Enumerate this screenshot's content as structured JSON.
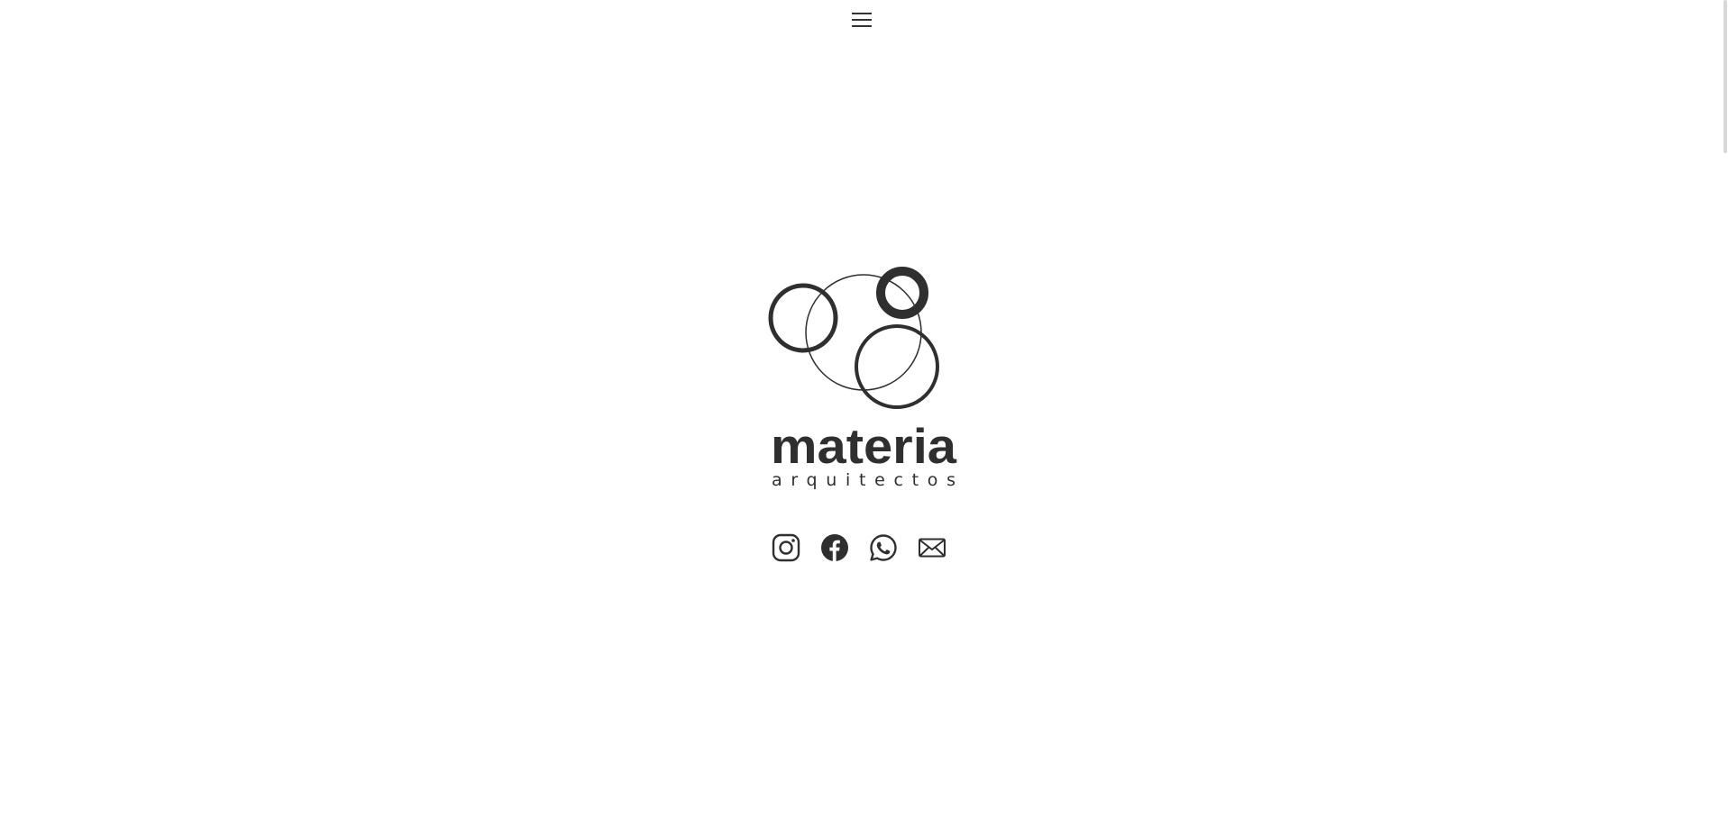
{
  "header": {
    "menu_icon": "hamburger-menu-icon"
  },
  "logo": {
    "wordmark": "materia",
    "tagline": "arquitectos"
  },
  "social": [
    {
      "name": "instagram",
      "icon": "instagram-icon"
    },
    {
      "name": "facebook",
      "icon": "facebook-icon"
    },
    {
      "name": "whatsapp",
      "icon": "whatsapp-icon"
    },
    {
      "name": "email",
      "icon": "envelope-icon"
    }
  ],
  "colors": {
    "background": "#ffffff",
    "logo": "#2f2f2f",
    "scrollbar_thumb": "#d8d8d8"
  }
}
